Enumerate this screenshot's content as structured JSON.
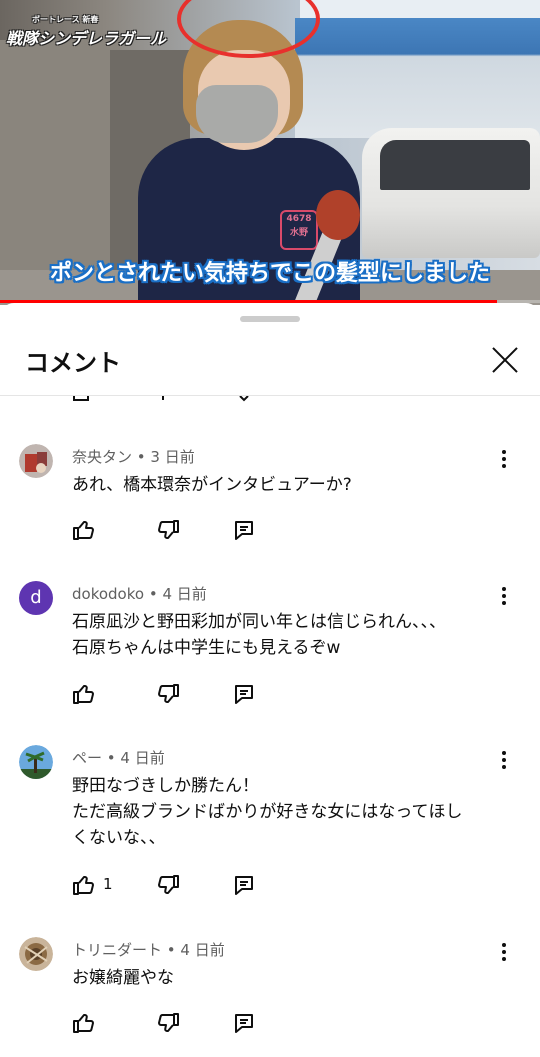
{
  "video": {
    "logo_line1": "ボートレース 新春",
    "logo_line2": "戦隊シンデレラガール",
    "badge_number": "4678",
    "badge_name": "水野",
    "caption": "ポンとされたい気持ちでこの髪型にしました",
    "progress": 0.92
  },
  "sheet": {
    "title": "コメント"
  },
  "comments": [
    {
      "author": "奈央タン",
      "time": "3 日前",
      "lines": [
        "あれ、橋本環奈がインタビュアーか?"
      ],
      "likes": "",
      "avatar_letter": "",
      "avatar_color": "#a94432"
    },
    {
      "author": "dokodoko",
      "time": "4 日前",
      "lines": [
        "石原凪沙と野田彩加が同い年とは信じられん、、、",
        "石原ちゃんは中学生にも見えるぞw"
      ],
      "likes": "",
      "avatar_letter": "d",
      "avatar_color": "#5e35b1"
    },
    {
      "author": "ペー",
      "time": "4 日前",
      "lines": [
        "野田なづきしか勝たん！",
        "ただ高級ブランドばかりが好きな女にはなってほし",
        "くないな、、"
      ],
      "likes": "1",
      "avatar_letter": "",
      "avatar_color": "#3d8fd1"
    },
    {
      "author": "トリニダート",
      "time": "4 日前",
      "lines": [
        "お嬢綺麗やな"
      ],
      "likes": "",
      "avatar_letter": "",
      "avatar_color": "#8b6a44"
    }
  ],
  "icons": {
    "like": "thumb-up-icon",
    "dislike": "thumb-down-icon",
    "reply": "reply-icon",
    "more": "more-vert-icon",
    "close": "close-icon"
  }
}
